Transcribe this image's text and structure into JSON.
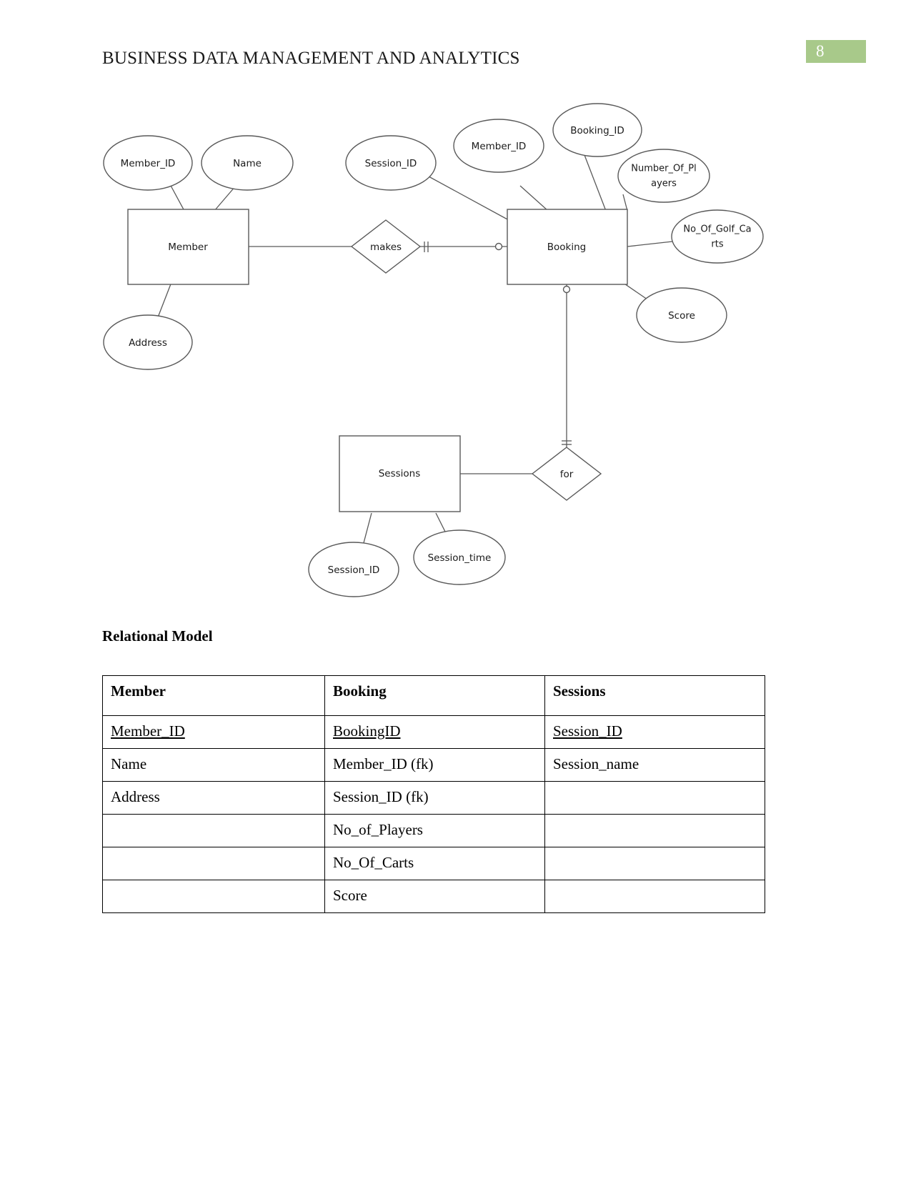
{
  "header": {
    "doc_title": "BUSINESS DATA MANAGEMENT AND ANALYTICS",
    "page_number": "8",
    "badge_color": "#a8c98a"
  },
  "diagram": {
    "entities": [
      {
        "name": "Member",
        "label": "Member"
      },
      {
        "name": "Booking",
        "label": "Booking"
      },
      {
        "name": "Sessions",
        "label": "Sessions"
      }
    ],
    "relationships": [
      {
        "name": "makes",
        "label": "makes"
      },
      {
        "name": "for",
        "label": "for"
      }
    ],
    "attributes": [
      {
        "name": "member-member-id",
        "label": "Member_ID"
      },
      {
        "name": "member-name",
        "label": "Name"
      },
      {
        "name": "member-address",
        "label": "Address"
      },
      {
        "name": "booking-session-id",
        "label": "Session_ID"
      },
      {
        "name": "booking-member-id",
        "label": "Member_ID"
      },
      {
        "name": "booking-booking-id",
        "label": "Booking_ID"
      },
      {
        "name": "booking-number-of-players-line1",
        "label": "Number_Of_Pl"
      },
      {
        "name": "booking-number-of-players-line2",
        "label": "ayers"
      },
      {
        "name": "booking-no-of-golf-carts-line1",
        "label": "No_Of_Golf_Ca"
      },
      {
        "name": "booking-no-of-golf-carts-line2",
        "label": "rts"
      },
      {
        "name": "booking-score",
        "label": "Score"
      },
      {
        "name": "sessions-session-id",
        "label": "Session_ID"
      },
      {
        "name": "sessions-session-time",
        "label": "Session_time"
      }
    ]
  },
  "relational_model": {
    "heading": "Relational Model",
    "columns": [
      "Member",
      "Booking",
      "Sessions"
    ],
    "rows": [
      {
        "cells": [
          "Member_ID",
          "BookingID",
          "Session_ID"
        ],
        "underline": [
          true,
          true,
          true
        ]
      },
      {
        "cells": [
          "Name",
          "Member_ID (fk)",
          "Session_name"
        ],
        "underline": [
          false,
          false,
          false
        ]
      },
      {
        "cells": [
          "Address",
          "Session_ID (fk)",
          ""
        ],
        "underline": [
          false,
          false,
          false
        ]
      },
      {
        "cells": [
          "",
          "No_of_Players",
          ""
        ],
        "underline": [
          false,
          false,
          false
        ]
      },
      {
        "cells": [
          "",
          "No_Of_Carts",
          ""
        ],
        "underline": [
          false,
          false,
          false
        ]
      },
      {
        "cells": [
          "",
          "Score",
          ""
        ],
        "underline": [
          false,
          false,
          false
        ]
      }
    ]
  }
}
